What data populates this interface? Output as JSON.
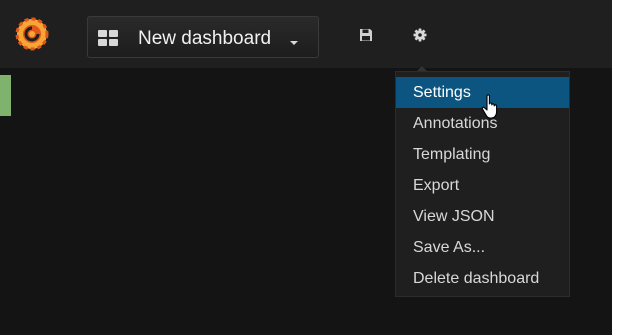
{
  "header": {
    "dashboard_title": "New dashboard"
  },
  "menu": {
    "items": [
      {
        "label": "Settings",
        "active": true
      },
      {
        "label": "Annotations",
        "active": false
      },
      {
        "label": "Templating",
        "active": false
      },
      {
        "label": "Export",
        "active": false
      },
      {
        "label": "View JSON",
        "active": false
      },
      {
        "label": "Save As...",
        "active": false
      },
      {
        "label": "Delete dashboard",
        "active": false
      }
    ]
  },
  "colors": {
    "accent": "#7eb26d",
    "active_item": "#0b5580",
    "background": "#141414",
    "topbar": "#1f1f1f"
  },
  "icons": [
    "grafana-logo-icon",
    "grid-icon",
    "caret-down-icon",
    "save-icon",
    "gear-icon",
    "hand-cursor-icon"
  ]
}
